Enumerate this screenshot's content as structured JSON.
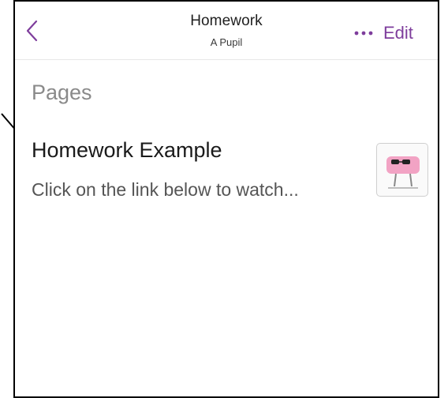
{
  "header": {
    "title": "Homework",
    "subtitle": "A Pupil",
    "edit_label": "Edit",
    "back_icon": "chevron-left-icon",
    "more_icon": "ellipsis-icon"
  },
  "section": {
    "heading": "Pages"
  },
  "pages": [
    {
      "title": "Homework Example",
      "preview": "Click on the link below to watch..."
    }
  ],
  "colors": {
    "accent": "#7e3d9c",
    "section_heading": "#8a8a8a",
    "preview_text": "#555555"
  }
}
